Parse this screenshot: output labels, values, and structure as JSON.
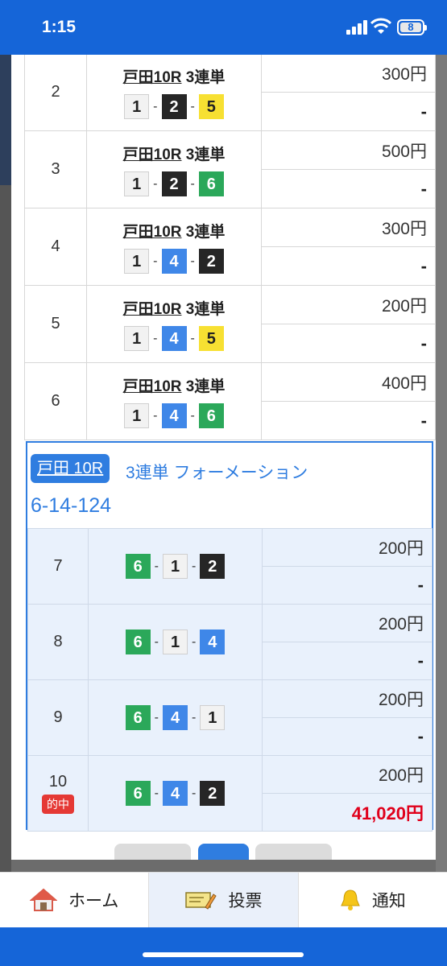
{
  "status": {
    "time": "1:15",
    "battery": "8"
  },
  "rows": [
    {
      "num": "2",
      "race": "戸田10R",
      "bet_type": "3連単",
      "chips": [
        "1",
        "2",
        "5"
      ],
      "amount": "300円",
      "payout": "-"
    },
    {
      "num": "3",
      "race": "戸田10R",
      "bet_type": "3連単",
      "chips": [
        "1",
        "2",
        "6"
      ],
      "amount": "500円",
      "payout": "-"
    },
    {
      "num": "4",
      "race": "戸田10R",
      "bet_type": "3連単",
      "chips": [
        "1",
        "4",
        "2"
      ],
      "amount": "300円",
      "payout": "-"
    },
    {
      "num": "5",
      "race": "戸田10R",
      "bet_type": "3連単",
      "chips": [
        "1",
        "4",
        "5"
      ],
      "amount": "200円",
      "payout": "-"
    },
    {
      "num": "6",
      "race": "戸田10R",
      "bet_type": "3連単",
      "chips": [
        "1",
        "4",
        "6"
      ],
      "amount": "400円",
      "payout": "-"
    }
  ],
  "formation": {
    "race": "戸田 10R",
    "type": "3連単 フォーメーション",
    "combo": "6-14-124",
    "rows": [
      {
        "num": "7",
        "chips": [
          "6",
          "1",
          "2"
        ],
        "amount": "200円",
        "payout": "-"
      },
      {
        "num": "8",
        "chips": [
          "6",
          "1",
          "4"
        ],
        "amount": "200円",
        "payout": "-"
      },
      {
        "num": "9",
        "chips": [
          "6",
          "4",
          "1"
        ],
        "amount": "200円",
        "payout": "-"
      },
      {
        "num": "10",
        "chips": [
          "6",
          "4",
          "2"
        ],
        "amount": "200円",
        "payout": "41,020円",
        "hit_label": "的中"
      }
    ]
  },
  "tabs": {
    "home": "ホーム",
    "vote": "投票",
    "notify": "通知"
  },
  "colors": {
    "header": "#1565d8",
    "accent": "#2f7de0",
    "hit": "#e0001b",
    "chip": {
      "1": "#f2f2f2",
      "2": "#262626",
      "4": "#3f87e8",
      "5": "#f7e032",
      "6": "#2ba85a"
    }
  }
}
